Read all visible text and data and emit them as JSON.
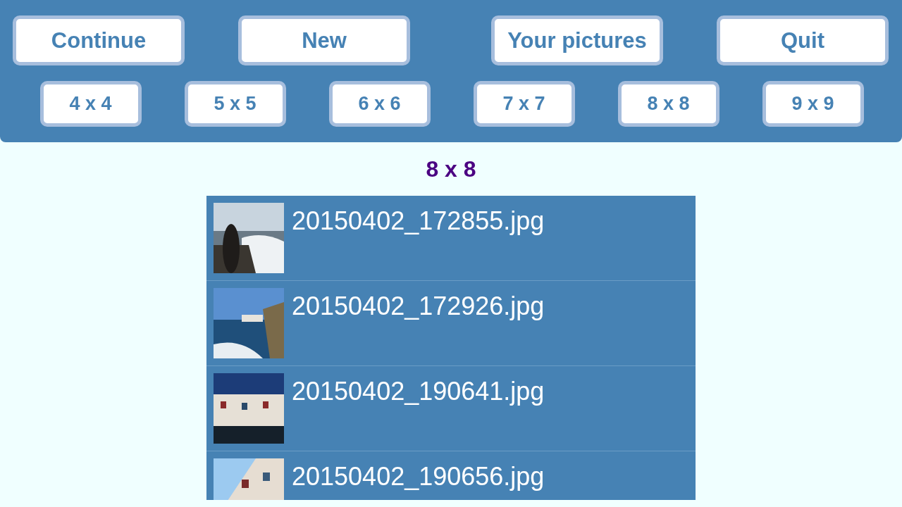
{
  "menu_buttons": [
    "Continue",
    "New",
    "Your pictures",
    "Quit"
  ],
  "size_buttons": [
    "4 x 4",
    "5 x 5",
    "6 x 6",
    "7 x 7",
    "8 x 8",
    "9 x 9"
  ],
  "heading": "8 x 8",
  "files": [
    {
      "name": "20150402_172855.jpg"
    },
    {
      "name": "20150402_172926.jpg"
    },
    {
      "name": "20150402_190641.jpg"
    },
    {
      "name": "20150402_190656.jpg"
    }
  ]
}
